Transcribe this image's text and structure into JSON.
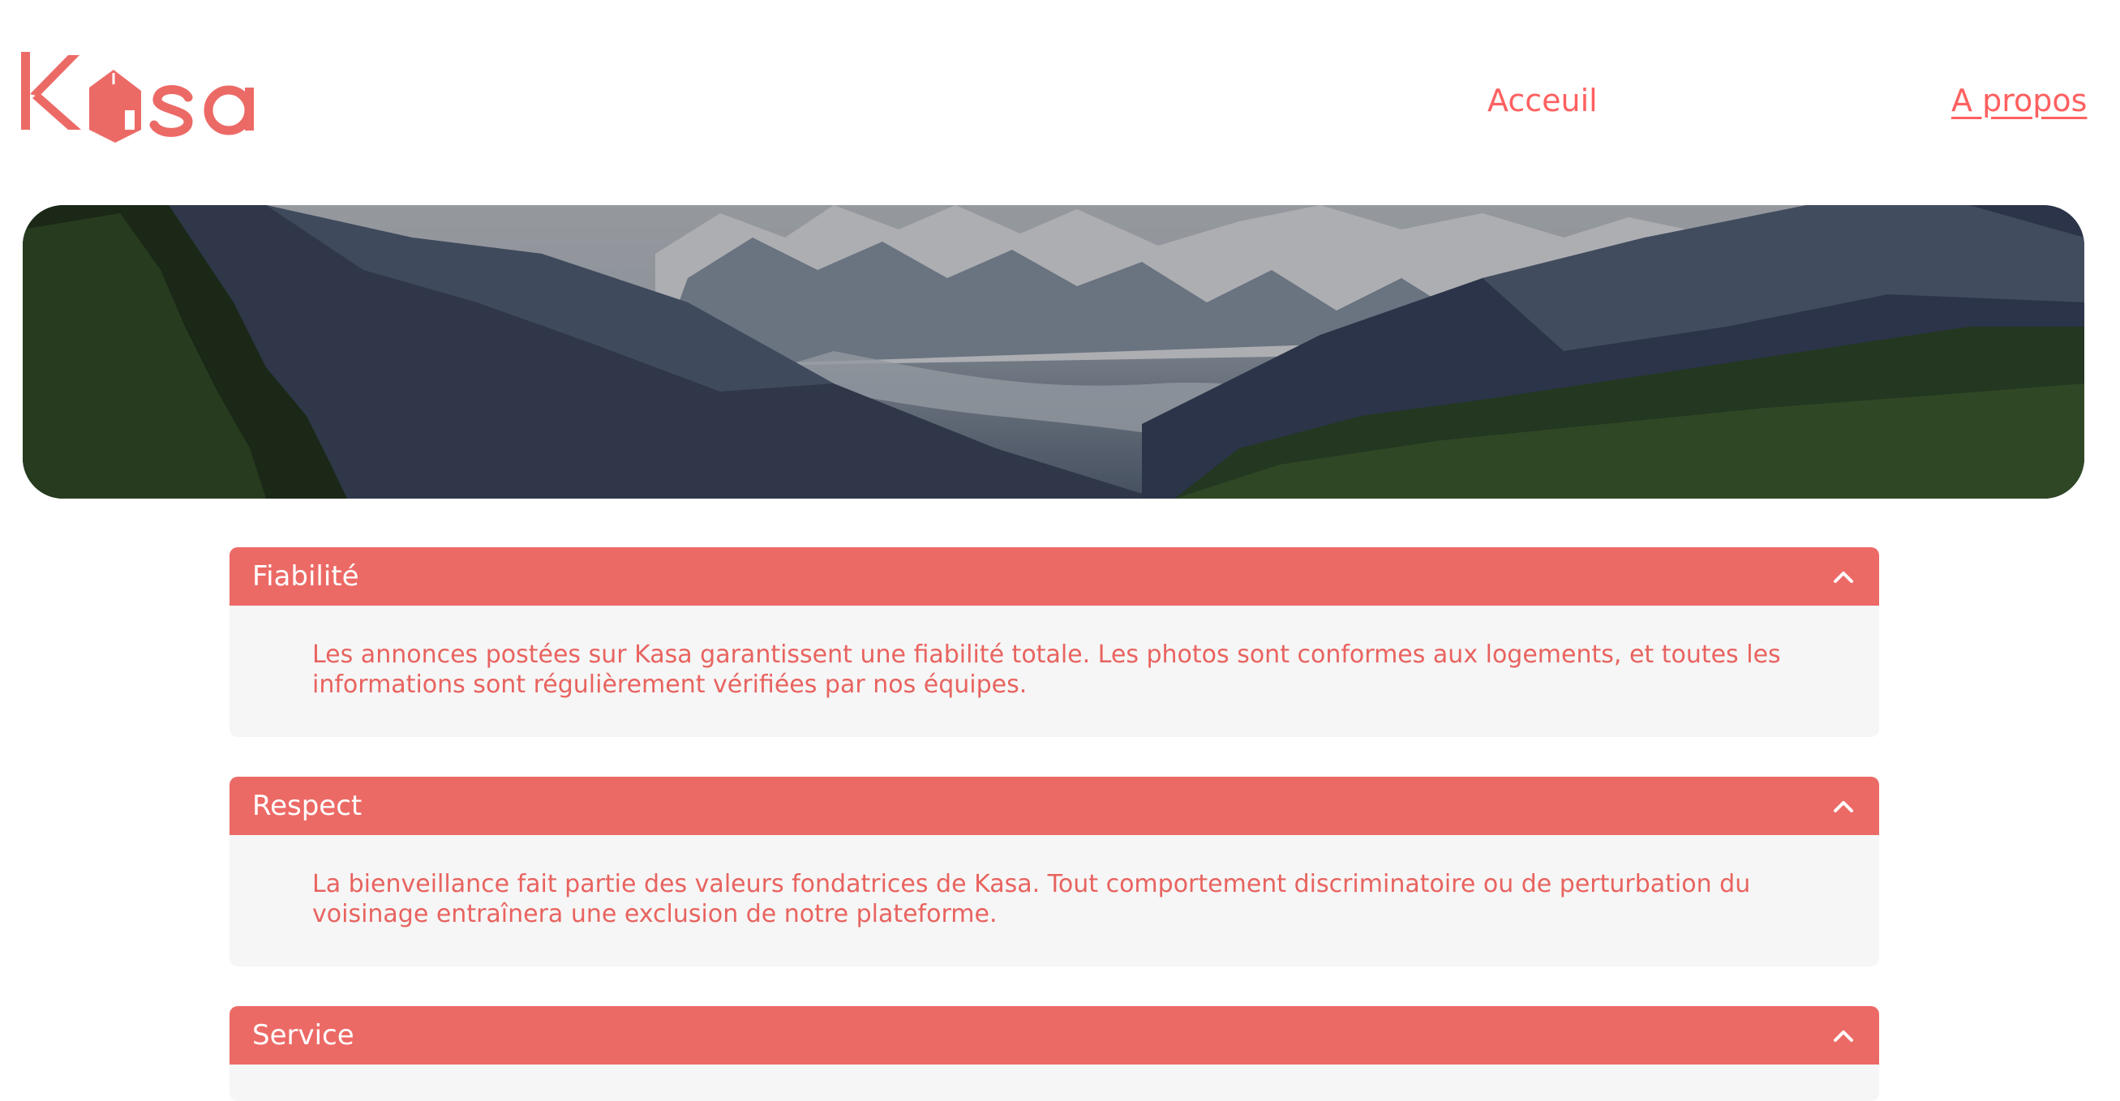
{
  "brand": {
    "name": "Kasa",
    "color": "#ff6060"
  },
  "nav": {
    "items": [
      {
        "label": "Acceuil",
        "active": false
      },
      {
        "label": "A propos",
        "active": true
      }
    ]
  },
  "banner": {
    "image": "mountain-valley-landscape"
  },
  "collapses": [
    {
      "title": "Fiabilité",
      "text": "Les annonces postées sur Kasa garantissent une fiabilité totale. Les photos sont conformes aux logements, et toutes les informations sont régulièrement vérifiées par nos équipes.",
      "icon": "chevron-up-icon"
    },
    {
      "title": "Respect",
      "text": "La bienveillance fait partie des valeurs fondatrices de Kasa. Tout comportement discriminatoire ou de perturbation du voisinage entraînera une exclusion de notre plateforme.",
      "icon": "chevron-up-icon"
    },
    {
      "title": "Service",
      "text": "",
      "icon": "chevron-up-icon"
    }
  ]
}
